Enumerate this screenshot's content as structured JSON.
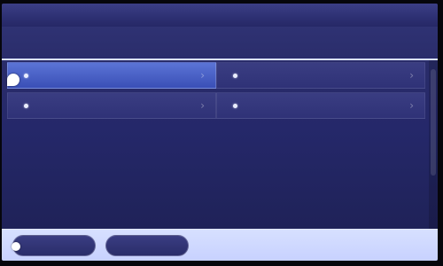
{
  "window": {
    "title": ""
  },
  "header": {
    "label": ""
  },
  "grid": {
    "rows": [
      [
        {
          "label": "",
          "selected": true
        },
        {
          "label": "",
          "selected": false
        }
      ],
      [
        {
          "label": "",
          "selected": false
        },
        {
          "label": "",
          "selected": false
        }
      ]
    ]
  },
  "footer": {
    "buttons": [
      {
        "label": ""
      },
      {
        "label": ""
      }
    ]
  },
  "colors": {
    "background": "#23255a",
    "accent": "#5b74d6",
    "footer": "#d7e0ff"
  }
}
